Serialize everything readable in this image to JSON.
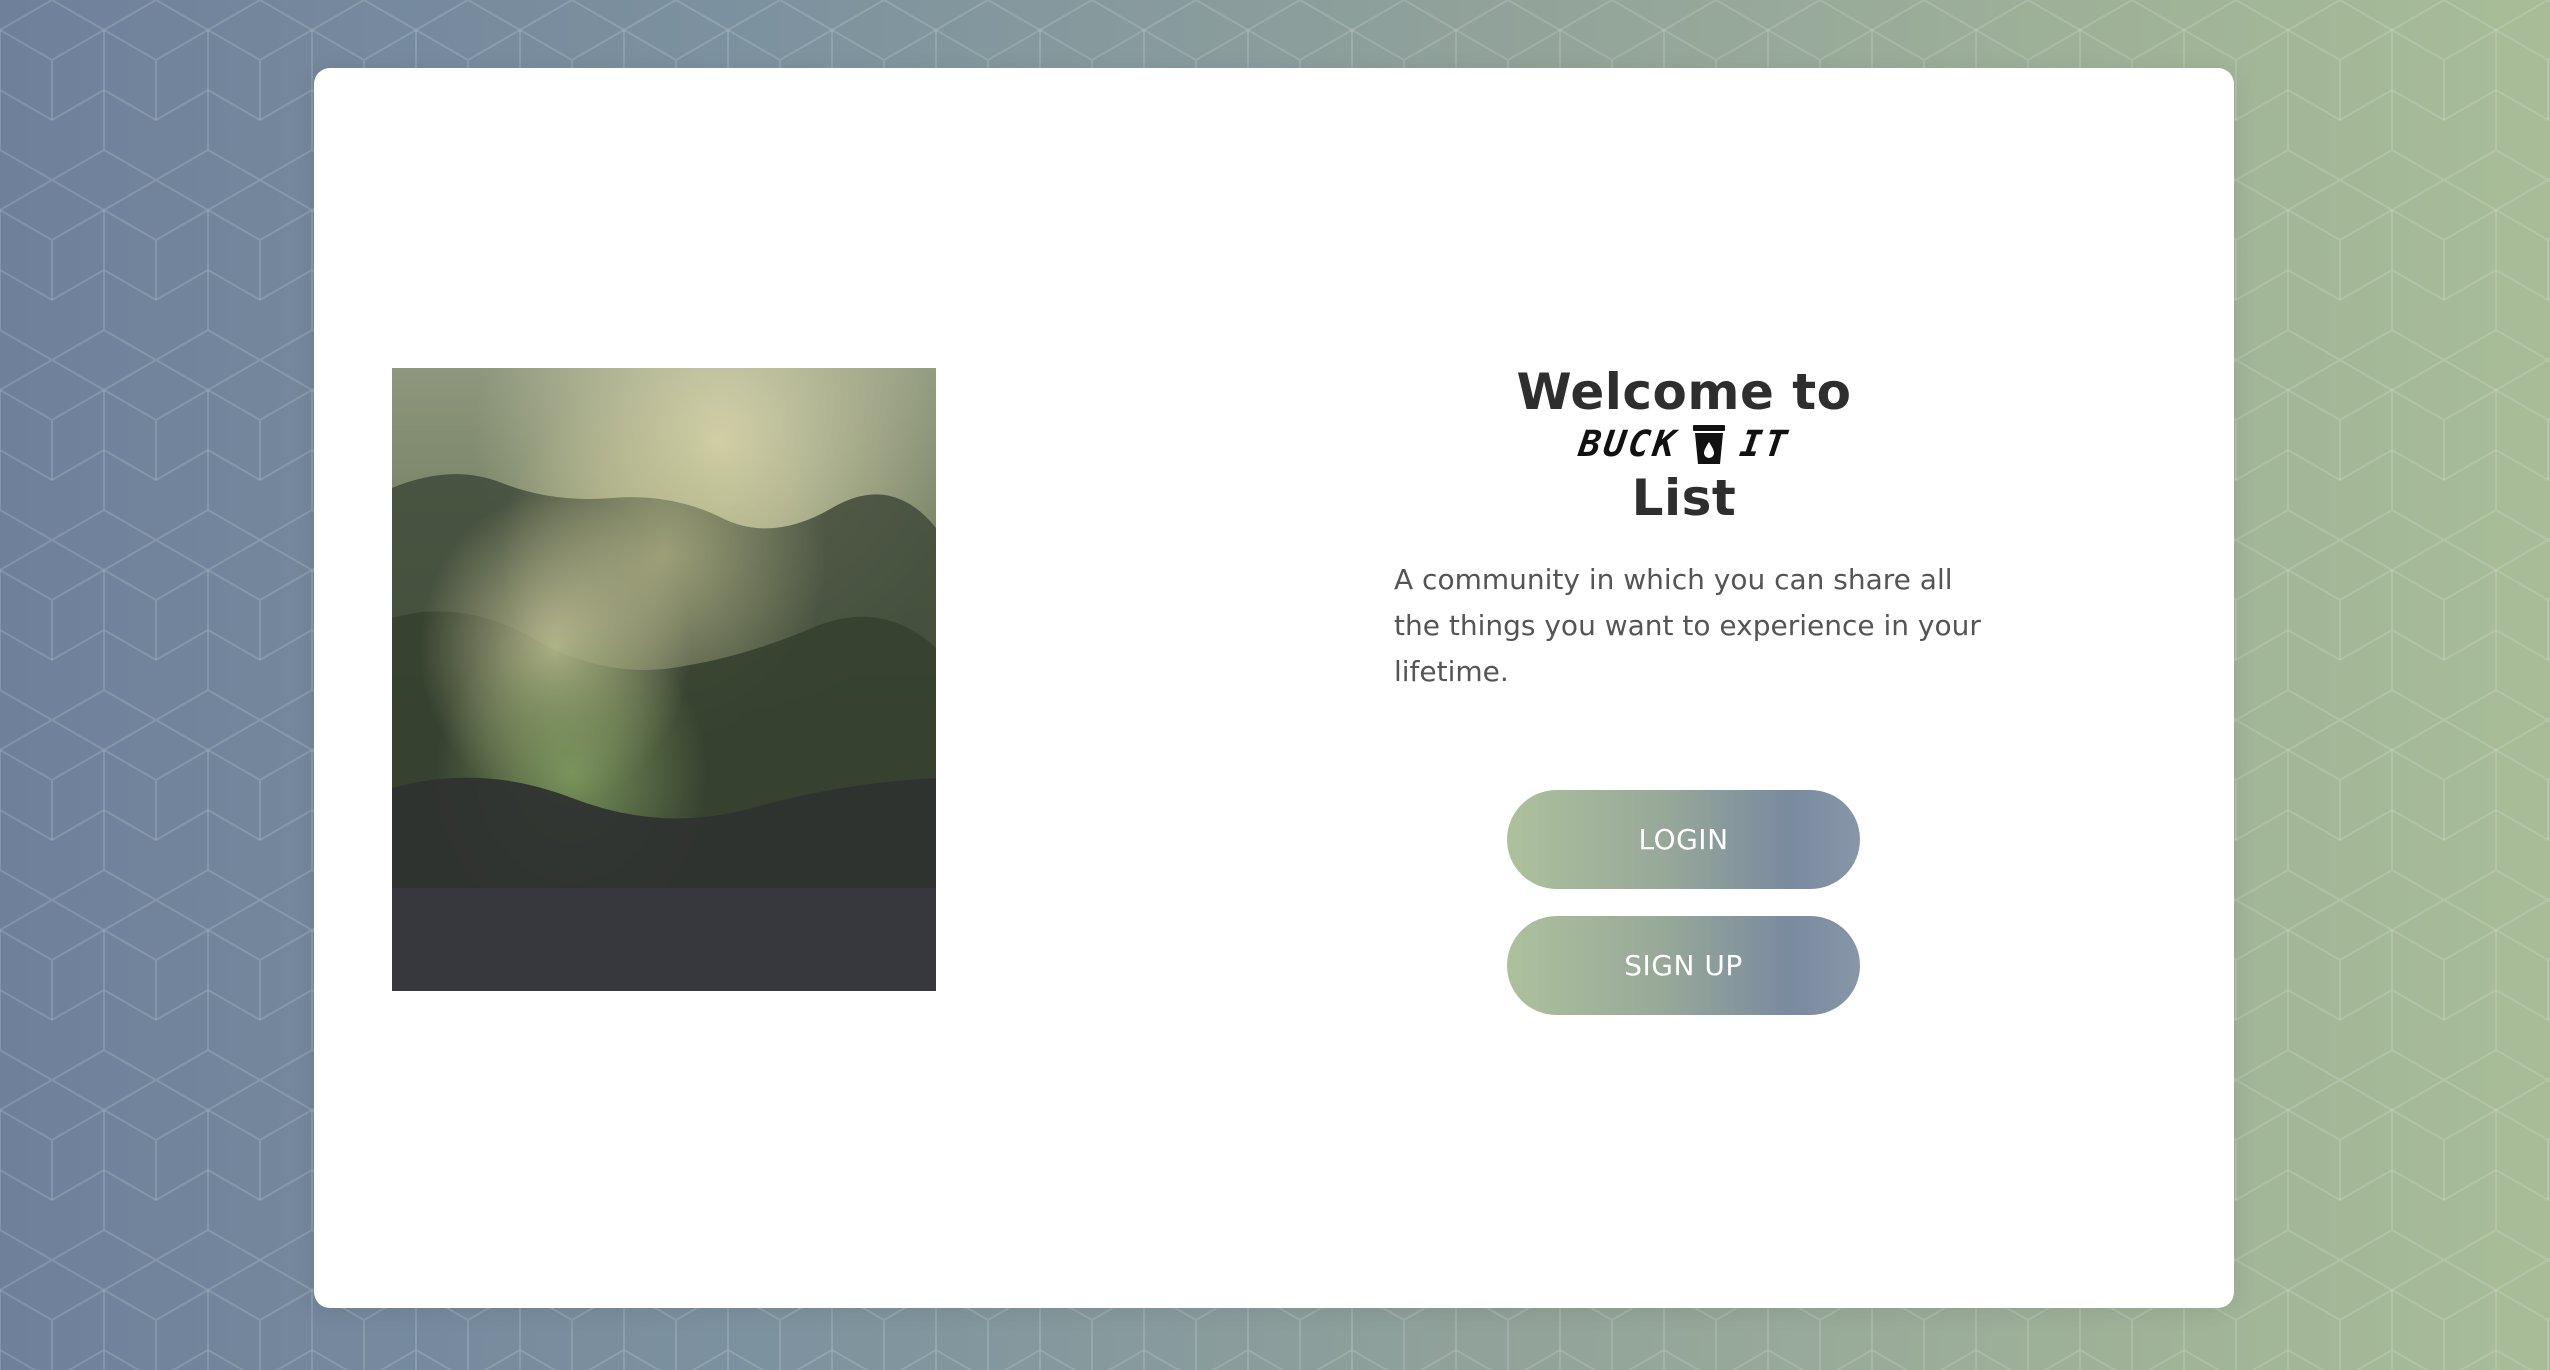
{
  "welcome": {
    "line1": "Welcome to",
    "brand_left": "BUCK",
    "brand_icon": "bucket-icon",
    "brand_right": "IT",
    "line3": "List"
  },
  "description": "A community in which you can share all the things you want to experience in your lifetime.",
  "buttons": {
    "login_label": "LOGIN",
    "signup_label": "SIGN UP"
  },
  "images": {
    "hero": "misty-forest-photo"
  },
  "colors": {
    "background_left": "#6f809b",
    "background_right": "#a8bd97",
    "card": "#ffffff",
    "heading_text": "#2e2e2e",
    "body_text": "#555555",
    "button_gradient_start": "#adc19c",
    "button_gradient_end": "#7a8a9f",
    "button_text": "#ffffff"
  }
}
